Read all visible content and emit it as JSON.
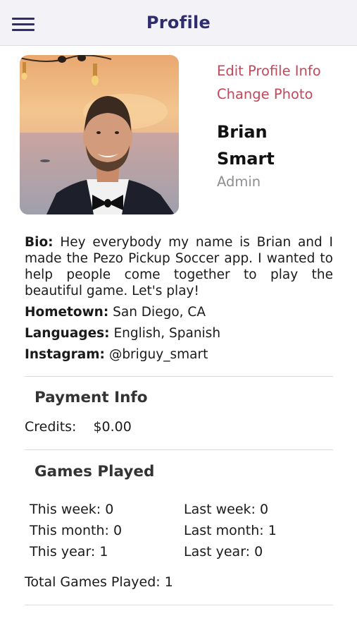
{
  "header": {
    "title": "Profile",
    "menu_icon": "hamburger-menu-icon"
  },
  "profile": {
    "photo_alt": "Profile photo",
    "edit_link": "Edit Profile Info",
    "change_photo_link": "Change Photo",
    "first_name": "Brian",
    "last_name": "Smart",
    "role": "Admin"
  },
  "about": {
    "bio_label": "Bio:",
    "bio_text": "Hey everybody my name is Brian and I made the Pezo Pickup Soccer app. I wanted to help people come together to play the beautiful game. Let's play!",
    "hometown_label": "Hometown:",
    "hometown": "San Diego, CA",
    "languages_label": "Languages:",
    "languages": "English, Spanish",
    "instagram_label": "Instagram:",
    "instagram": "@briguy_smart"
  },
  "payment": {
    "title": "Payment Info",
    "credits_label": "Credits:",
    "credits_value": "$0.00"
  },
  "games": {
    "title": "Games Played",
    "this_week": "This week: 0",
    "last_week": "Last week: 0",
    "this_month": "This month: 0",
    "last_month": "Last month: 1",
    "this_year": "This year: 1",
    "last_year": "Last year: 0",
    "total": "Total Games Played: 1"
  },
  "colors": {
    "header_title": "#2f2d6e",
    "link": "#c2485a",
    "muted": "#8e8e93",
    "header_bg": "#f2f2f7"
  }
}
